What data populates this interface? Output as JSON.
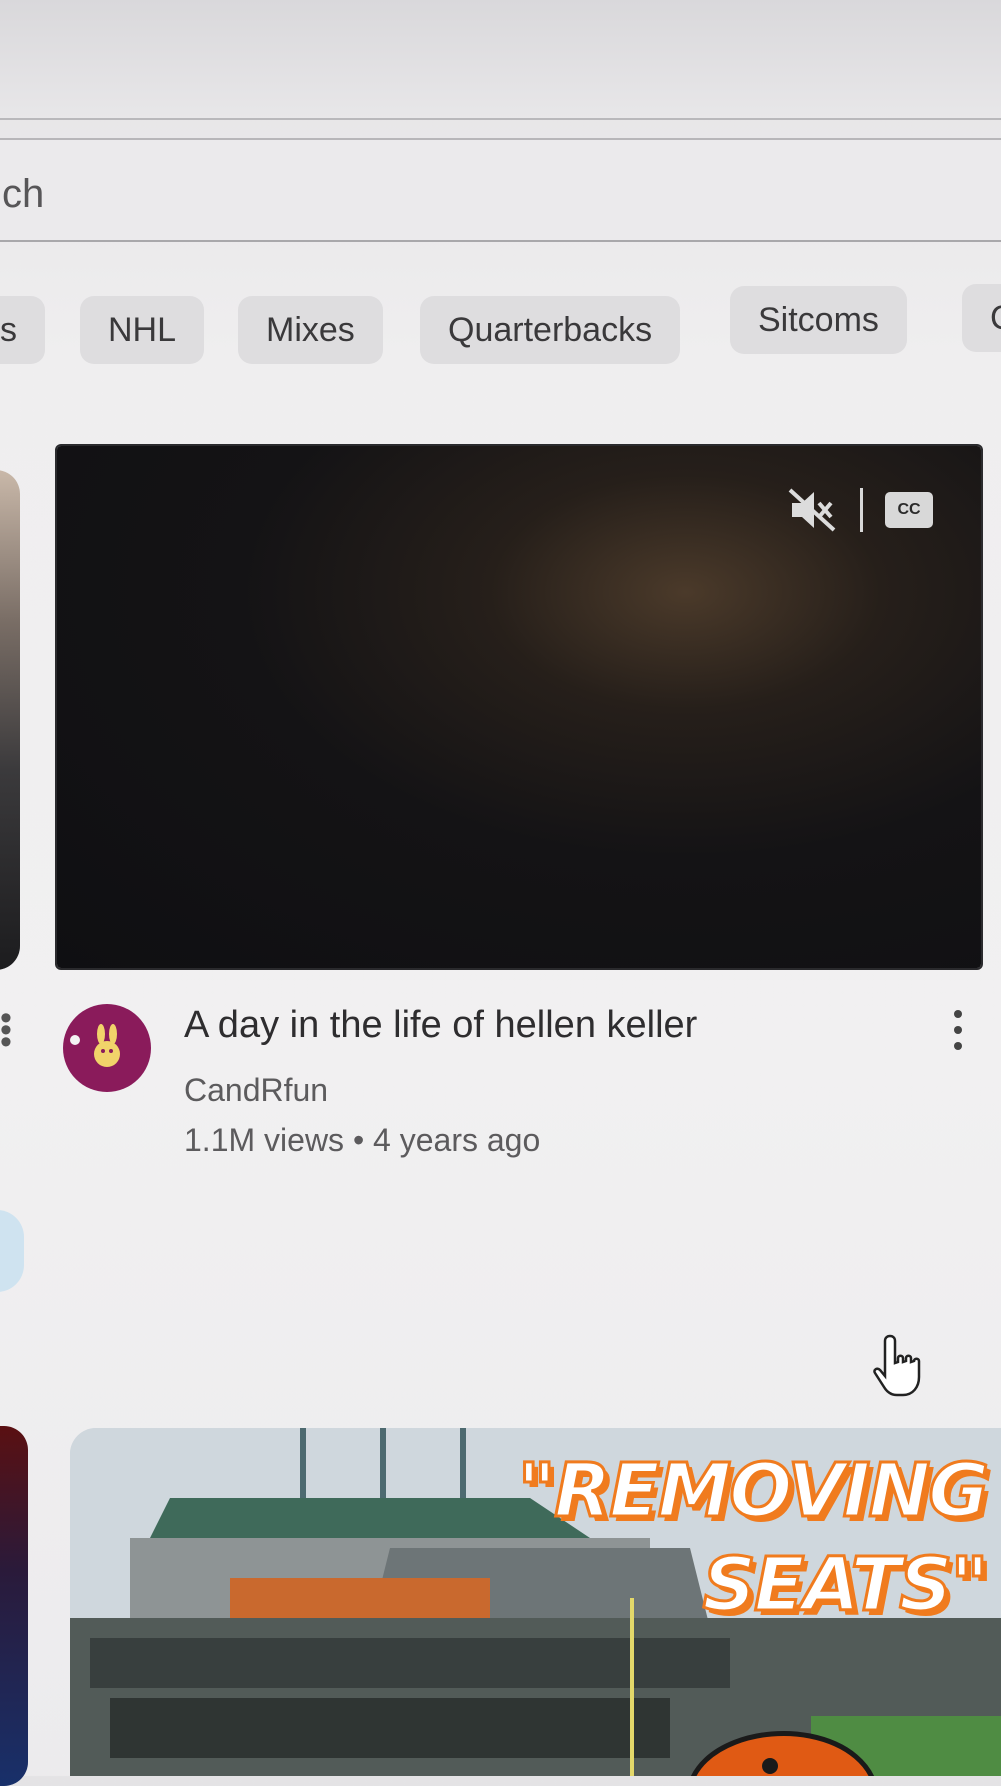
{
  "search": {
    "text": "ch"
  },
  "chips": [
    "s",
    "NHL",
    "Mixes",
    "Quarterbacks",
    "Sitcoms",
    "C"
  ],
  "player": {
    "mute_icon": "volume-off-icon",
    "cc_label": "CC"
  },
  "video": {
    "title": "A day in the life of hellen keller",
    "channel": "CandRfun",
    "meta": "1.1M views • 4 years ago"
  },
  "next_video": {
    "thumbnail_text_line1": "\"REMOVING",
    "thumbnail_text_line2": "SEATS\""
  },
  "colors": {
    "accent_orange": "#f07b1e",
    "avatar_purple": "#8a1b5b"
  }
}
